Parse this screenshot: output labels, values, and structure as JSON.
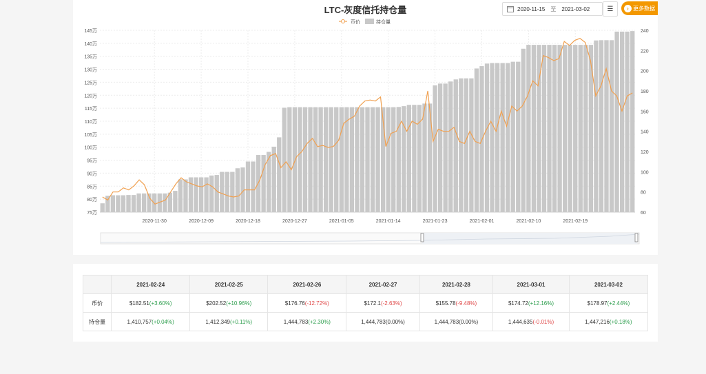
{
  "chart_data": {
    "type": "bar+line",
    "title": "LTC-灰度信托持仓量",
    "legend": [
      "币价",
      "持仓量"
    ],
    "legend_position": "top-center",
    "left_axis": {
      "ticks": [
        "75万",
        "80万",
        "85万",
        "90万",
        "95万",
        "100万",
        "105万",
        "110万",
        "115万",
        "120万",
        "125万",
        "130万",
        "135万",
        "140万",
        "145万"
      ],
      "min": 750000,
      "max": 1450000
    },
    "right_axis": {
      "ticks": [
        "60",
        "80",
        "100",
        "120",
        "140",
        "160",
        "180",
        "200",
        "220",
        "240"
      ],
      "min": 60,
      "max": 240
    },
    "x_ticks": [
      "2020-11-30",
      "2020-12-09",
      "2020-12-18",
      "2020-12-27",
      "2021-01-05",
      "2021-01-14",
      "2021-01-23",
      "2021-02-01",
      "2021-02-10",
      "2021-02-19"
    ],
    "x_tick_positions": [
      10,
      19,
      28,
      37,
      46,
      55,
      64,
      73,
      82,
      91
    ],
    "colors": {
      "bar": "#c8c8c8",
      "line": "#f0a050",
      "accent": "#f39800"
    },
    "holdings": [
      784000,
      813000,
      815000,
      815000,
      815000,
      816000,
      816000,
      822000,
      822000,
      822000,
      822000,
      822000,
      822000,
      825000,
      832000,
      876000,
      876000,
      884000,
      884000,
      884000,
      884000,
      891000,
      893000,
      905000,
      905000,
      905000,
      919000,
      922000,
      945000,
      945000,
      970000,
      970000,
      982000,
      1002000,
      1038000,
      1152000,
      1154000,
      1154000,
      1154000,
      1154000,
      1154000,
      1154000,
      1154000,
      1154000,
      1154000,
      1154000,
      1154000,
      1154000,
      1154000,
      1154000,
      1154000,
      1154000,
      1154000,
      1154000,
      1154000,
      1154000,
      1154000,
      1155000,
      1158000,
      1163000,
      1163000,
      1163000,
      1168000,
      1168000,
      1238000,
      1245000,
      1245000,
      1253000,
      1261000,
      1265000,
      1265000,
      1265000,
      1303000,
      1312000,
      1322000,
      1324000,
      1324000,
      1324000,
      1324000,
      1329000,
      1329000,
      1379000,
      1394000,
      1394000,
      1394000,
      1394000,
      1394000,
      1394000,
      1394000,
      1394000,
      1394000,
      1394000,
      1394000,
      1394000,
      1394000,
      1411000,
      1412000,
      1412000,
      1412000,
      1445000,
      1445000,
      1445000,
      1447000
    ],
    "price": [
      75,
      72,
      80,
      80,
      84,
      82,
      86,
      92,
      87,
      74,
      68,
      70,
      72,
      80,
      88,
      94,
      90,
      88,
      86,
      85,
      88,
      85,
      80,
      78,
      76,
      75,
      76,
      82,
      82,
      82,
      92,
      107,
      116,
      118,
      104,
      110,
      102,
      115,
      120,
      128,
      133,
      125,
      126,
      124,
      125,
      131,
      148,
      152,
      155,
      165,
      170,
      171,
      170,
      174,
      125,
      138,
      140,
      150,
      140,
      150,
      147,
      152,
      180,
      130,
      142,
      140,
      140,
      144,
      130,
      128,
      140,
      130,
      128,
      140,
      150,
      140,
      160,
      145,
      165,
      160,
      165,
      175,
      190,
      185,
      215,
      213,
      210,
      212,
      229,
      225,
      230,
      232,
      228,
      210,
      175,
      185,
      202,
      180,
      175,
      160,
      175,
      178
    ],
    "table": {
      "row_label_price": "币价",
      "row_label_holdings": "持仓量",
      "columns": [
        {
          "date": "2021-02-24",
          "price": "$182.51",
          "price_chg": "(+3.60%)",
          "price_dir": "up",
          "hold": "1,410,757",
          "hold_chg": "(+0.04%)",
          "hold_dir": "up"
        },
        {
          "date": "2021-02-25",
          "price": "$202.52",
          "price_chg": "(+10.96%)",
          "price_dir": "up",
          "hold": "1,412,349",
          "hold_chg": "(+0.11%)",
          "hold_dir": "up"
        },
        {
          "date": "2021-02-26",
          "price": "$176.76",
          "price_chg": "(-12.72%)",
          "price_dir": "down",
          "hold": "1,444,783",
          "hold_chg": "(+2.30%)",
          "hold_dir": "up"
        },
        {
          "date": "2021-02-27",
          "price": "$172.1",
          "price_chg": "(-2.63%)",
          "price_dir": "down",
          "hold": "1,444,783",
          "hold_chg": "(0.00%)",
          "hold_dir": "none"
        },
        {
          "date": "2021-02-28",
          "price": "$155.78",
          "price_chg": "(-9.48%)",
          "price_dir": "down",
          "hold": "1,444,783",
          "hold_chg": "(0.00%)",
          "hold_dir": "none"
        },
        {
          "date": "2021-03-01",
          "price": "$174.72",
          "price_chg": "(+12.16%)",
          "price_dir": "up",
          "hold": "1,444,635",
          "hold_chg": "(-0.01%)",
          "hold_dir": "down"
        },
        {
          "date": "2021-03-02",
          "price": "$178.97",
          "price_chg": "(+2.44%)",
          "price_dir": "up",
          "hold": "1,447,216",
          "hold_chg": "(+0.18%)",
          "hold_dir": "up"
        }
      ]
    }
  },
  "controls": {
    "date_from": "2020-11-15",
    "date_sep": "至",
    "date_to": "2021-03-02",
    "menu_icon": "hamburger-icon",
    "more_label": "更多数据"
  }
}
